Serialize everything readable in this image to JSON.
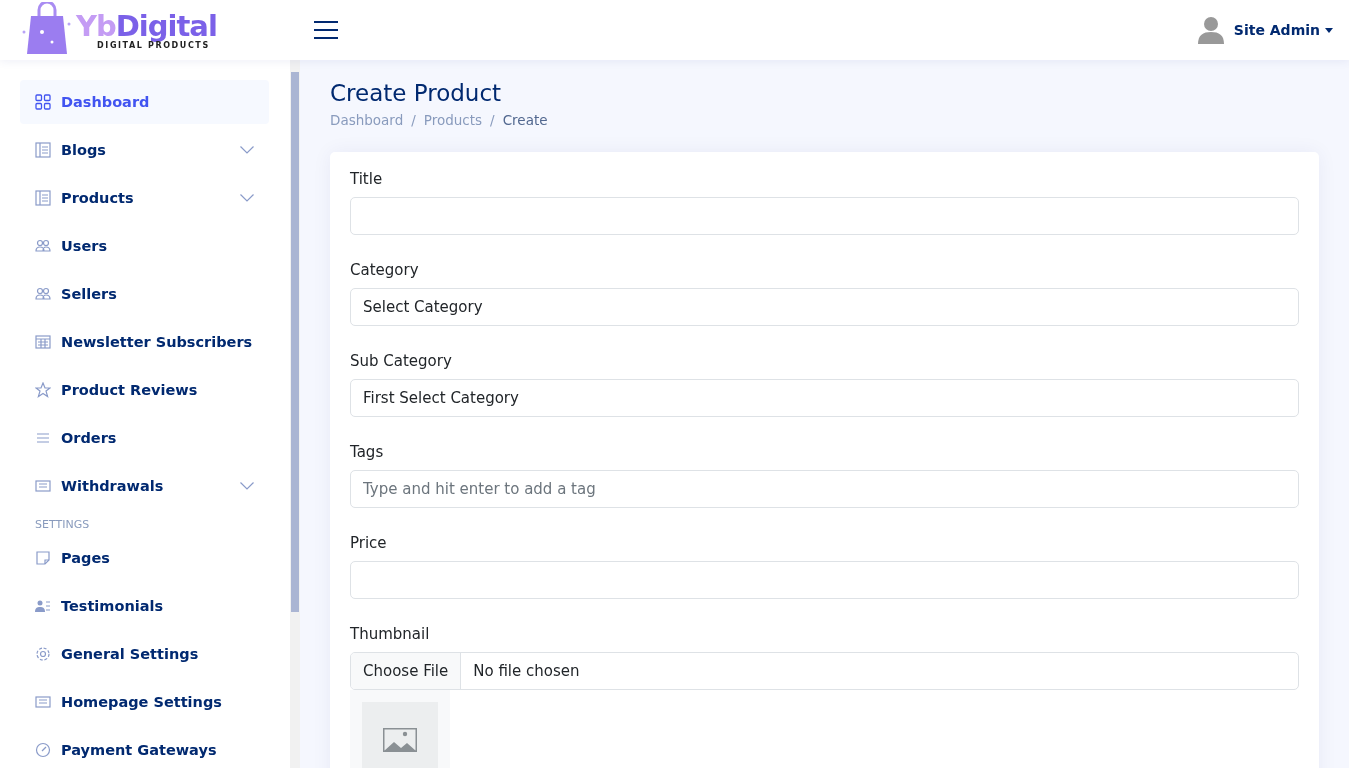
{
  "header": {
    "logo": {
      "prefix": "Yb",
      "name": "Digital",
      "tagline": "DIGITAL PRODUCTS"
    },
    "user": {
      "name": "Site Admin"
    }
  },
  "sidebar": {
    "items": [
      {
        "kind": "item",
        "label": "Dashboard",
        "selected": true,
        "expandable": false
      },
      {
        "kind": "item",
        "label": "Blogs",
        "selected": false,
        "expandable": true
      },
      {
        "kind": "item",
        "label": "Products",
        "selected": false,
        "expandable": true
      },
      {
        "kind": "item",
        "label": "Users",
        "selected": false,
        "expandable": false
      },
      {
        "kind": "item",
        "label": "Sellers",
        "selected": false,
        "expandable": false
      },
      {
        "kind": "item",
        "label": "Newsletter Subscribers",
        "selected": false,
        "expandable": false
      },
      {
        "kind": "item",
        "label": "Product Reviews",
        "selected": false,
        "expandable": false
      },
      {
        "kind": "item",
        "label": "Orders",
        "selected": false,
        "expandable": false
      },
      {
        "kind": "item",
        "label": "Withdrawals",
        "selected": false,
        "expandable": true
      },
      {
        "kind": "heading",
        "label": "SETTINGS"
      },
      {
        "kind": "item",
        "label": "Pages",
        "selected": false,
        "expandable": false
      },
      {
        "kind": "item",
        "label": "Testimonials",
        "selected": false,
        "expandable": false
      },
      {
        "kind": "item",
        "label": "General Settings",
        "selected": false,
        "expandable": false
      },
      {
        "kind": "item",
        "label": "Homepage Settings",
        "selected": false,
        "expandable": false
      },
      {
        "kind": "item",
        "label": "Payment Gateways",
        "selected": false,
        "expandable": false
      }
    ]
  },
  "page": {
    "title": "Create Product",
    "breadcrumb": [
      "Dashboard",
      "Products",
      "Create"
    ],
    "separators": [
      "/",
      "/"
    ]
  },
  "form": {
    "fields": [
      {
        "kind": "text",
        "label": "Title"
      },
      {
        "kind": "select",
        "label": "Category",
        "value": "Select Category"
      },
      {
        "kind": "select",
        "label": "Sub Category",
        "value": "First Select Category"
      },
      {
        "kind": "text",
        "label": "Tags",
        "placeholder": "Type and hit enter to add a tag"
      },
      {
        "kind": "text",
        "label": "Price"
      },
      {
        "kind": "file",
        "label": "Thumbnail",
        "button": "Choose File",
        "value": "No file chosen"
      }
    ]
  }
}
